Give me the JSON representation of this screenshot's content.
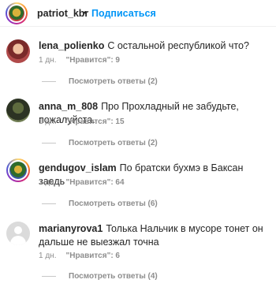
{
  "header": {
    "username": "patriot_kbr",
    "separator": "•",
    "follow_label": "Подписаться"
  },
  "comments": [
    {
      "username": "lena_polienko",
      "text": "С остальной республикой что?",
      "time": "1 дн.",
      "likes": "\"Нравится\": 9",
      "replies": "Посмотреть ответы (2)"
    },
    {
      "username": "anna_m_808",
      "text": "Про Прохладный не забудьте, пожалуйста.",
      "time": "1 дн.",
      "likes": "\"Нравится\": 15",
      "replies": "Посмотреть ответы (2)"
    },
    {
      "username": "gendugov_islam",
      "text": "По братски бухмэ в Баксан заедь",
      "time": "1 дн.",
      "likes": "\"Нравится\": 64",
      "replies": "Посмотреть ответы (6)"
    },
    {
      "username": "marianyrova1",
      "text": "Толька Нальчик в мусоре тонет он дальше не выезжал точна",
      "time": "1 дн.",
      "likes": "\"Нравится\": 6",
      "replies": "Посмотреть ответы (4)"
    }
  ]
}
